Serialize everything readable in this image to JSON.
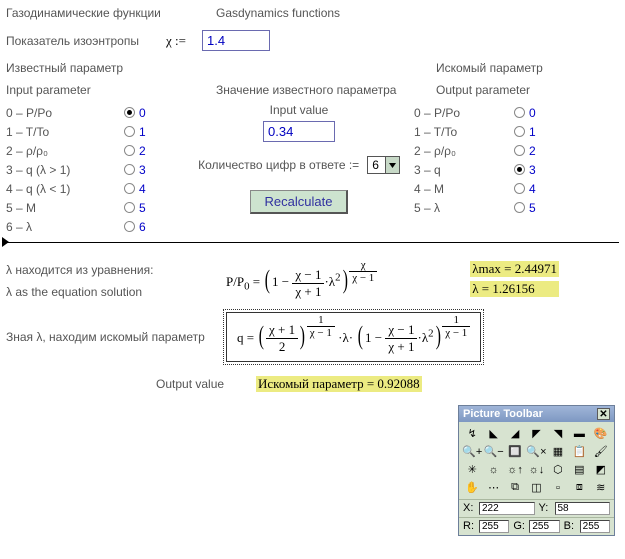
{
  "header": {
    "title_ru": "Газодинамические функции",
    "title_en": "Gasdynamics functions",
    "isentrope_ru": "Показатель изоэнтропы",
    "chi_sym": "χ :=",
    "chi_value": "1.4",
    "known_ru": "Известный параметр",
    "sought_ru": "Искомый параметр",
    "input_param_en": "Input parameter",
    "known_val_ru": "Значение известного параметра",
    "output_param_en": "Output  parameter",
    "input_value_en": "Input value",
    "input_value": "0.34",
    "digits_ru": "Количество цифр в ответе  :=",
    "digits_value": "6",
    "recalc": "Recalculate"
  },
  "radios_left": {
    "labels": [
      "0 – P/Po",
      "1 – T/To",
      "2 – ρ/ρ₀",
      "3 – q   (λ > 1)",
      "4 – q   (λ < 1)",
      "5 – M",
      "6 – λ"
    ],
    "digits": [
      "0",
      "1",
      "2",
      "3",
      "4",
      "5",
      "6"
    ],
    "selected": 0
  },
  "radios_right": {
    "labels": [
      "0 – P/Po",
      "1 – T/To",
      "2 – ρ/ρ₀",
      "3 – q",
      "4 – M",
      "5 – λ"
    ],
    "digits": [
      "0",
      "1",
      "2",
      "3",
      "4",
      "5"
    ],
    "selected": 3
  },
  "solution": {
    "lambda_line_ru": "λ находится из уравнения:",
    "lambda_line_en": "λ as the equation solution",
    "lambda_max_label": "λmax = ",
    "lambda_max_val": "2.44971",
    "lambda_label": "λ  = ",
    "lambda_val": "1.26156",
    "known_line_ru": "Зная λ, находим искомый параметр",
    "output_value_en": "Output value",
    "result_label": "Искомый параметр   = ",
    "result_val": "0.92088"
  },
  "toolbar": {
    "title": "Picture Toolbar",
    "x_label": "X:",
    "x_val": "222",
    "y_label": "Y:",
    "y_val": "58",
    "r_label": "R:",
    "r_val": "255",
    "g_label": "G:",
    "g_val": "255",
    "b_label": "B:",
    "b_val": "255",
    "icon_hints": [
      "arrow",
      "flip-h",
      "flip-v",
      "skew-l",
      "skew-r",
      "line",
      "color",
      "zoom-in",
      "zoom-out",
      "zoom-box",
      "zoom-cancel",
      "grid",
      "clipboard",
      "paint",
      "star",
      "bright",
      "bright-up",
      "bright-dn",
      "poly",
      "table",
      "mask",
      "hand",
      "dotted",
      "crop",
      "fill",
      "point",
      "move",
      "layers"
    ],
    "icon_glyphs": [
      "↯",
      "◣",
      "◢",
      "◤",
      "◥",
      "▬",
      "🎨",
      "🔍+",
      "🔍−",
      "🔲",
      "🔍×",
      "▦",
      "📋",
      "🖌",
      "✳",
      "☼",
      "☼↑",
      "☼↓",
      "⬡",
      "▤",
      "◩",
      "✋",
      "⋯",
      "⧉",
      "◫",
      "▫",
      "⧈",
      "≋"
    ]
  }
}
